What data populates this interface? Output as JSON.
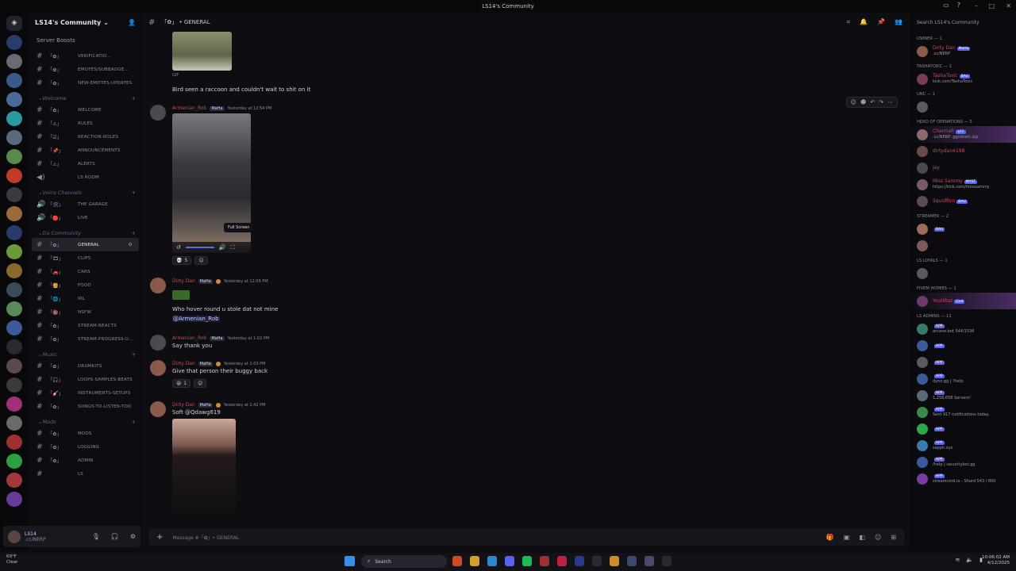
{
  "window": {
    "title": "LS14's Community"
  },
  "server": {
    "name": "LS14's Community",
    "boosts_label": "Server Boosts"
  },
  "channels": [
    {
      "type": "channel",
      "icon": "#",
      "emoji": "「✿」",
      "name": "verificatio..."
    },
    {
      "type": "channel",
      "icon": "#",
      "emoji": "「✿」",
      "name": "EMOTES/SUBBADGE..."
    },
    {
      "type": "channel",
      "icon": "#",
      "emoji": "「✿」",
      "name": "NEW-EMOTES-UPDATES"
    },
    {
      "type": "category",
      "name": "Welcome"
    },
    {
      "type": "channel",
      "icon": "#",
      "emoji": "「✿」",
      "name": "WELCOME"
    },
    {
      "type": "channel",
      "icon": "#",
      "emoji": "「⚠」",
      "name": "RULES"
    },
    {
      "type": "channel",
      "icon": "#",
      "emoji": "「☑」",
      "name": "REACTION-ROLES"
    },
    {
      "type": "channel",
      "icon": "#",
      "emoji": "「📌」",
      "name": "ANNOUNCEMENTS"
    },
    {
      "type": "channel",
      "icon": "#",
      "emoji": "「⚠」",
      "name": "ALERTS"
    },
    {
      "type": "channel",
      "icon": "◀)",
      "emoji": "",
      "name": "LS ROOM"
    },
    {
      "type": "category",
      "name": "Voice Channels"
    },
    {
      "type": "channel",
      "icon": "🔊",
      "emoji": "「🛠」",
      "name": "THE GARAGE"
    },
    {
      "type": "channel",
      "icon": "🔊",
      "emoji": "「🔴」",
      "name": "LIVE"
    },
    {
      "type": "category",
      "name": "Da Community"
    },
    {
      "type": "channel",
      "icon": "#",
      "emoji": "「✿」",
      "name": "GENERAL",
      "active": true
    },
    {
      "type": "channel",
      "icon": "#",
      "emoji": "「🎞」",
      "name": "CLIPS"
    },
    {
      "type": "channel",
      "icon": "#",
      "emoji": "「🚗」",
      "name": "CARS"
    },
    {
      "type": "channel",
      "icon": "#",
      "emoji": "「🍔」",
      "name": "FOOD"
    },
    {
      "type": "channel",
      "icon": "#",
      "emoji": "「🌐」",
      "name": "IRL"
    },
    {
      "type": "channel",
      "icon": "#",
      "emoji": "「🔞」",
      "name": "NSFW"
    },
    {
      "type": "channel",
      "icon": "#",
      "emoji": "「✿」",
      "name": "STREAM-REACTS"
    },
    {
      "type": "channel",
      "icon": "#",
      "emoji": "「✿」",
      "name": "STREAM-PROGRESS-U..."
    },
    {
      "type": "category",
      "name": "Music"
    },
    {
      "type": "channel",
      "icon": "#",
      "emoji": "「✿」",
      "name": "DRUMKITS"
    },
    {
      "type": "channel",
      "icon": "#",
      "emoji": "「🎧」",
      "name": "LOOPS-SAMPLES-BEATS"
    },
    {
      "type": "channel",
      "icon": "#",
      "emoji": "「🎸」",
      "name": "INSTRUMENTS-SETUPS"
    },
    {
      "type": "channel",
      "icon": "#",
      "emoji": "「✿」",
      "name": "SONGS-TO-LISTEN-TOO"
    },
    {
      "type": "category",
      "name": "Mods"
    },
    {
      "type": "channel",
      "icon": "#",
      "emoji": "「✿」",
      "name": "MODS"
    },
    {
      "type": "channel",
      "icon": "#",
      "emoji": "「✿」",
      "name": "LOGGING"
    },
    {
      "type": "channel",
      "icon": "#",
      "emoji": "「✿」",
      "name": "ADMIN"
    },
    {
      "type": "channel",
      "icon": "#",
      "emoji": "",
      "name": "ls"
    }
  ],
  "user_panel": {
    "name": "LS14",
    "status": ".cc/NERP"
  },
  "header": {
    "channel": "「✿」 • GENERAL"
  },
  "messages": {
    "gif_label": "GIF",
    "first_text": "Bird seen a raccoon and couldn't wait to shit on it",
    "m1": {
      "user": "Armenian_Rob",
      "tag": "MaHa",
      "time": "Yesterday at 12:54 PM",
      "reaction_count": "5"
    },
    "tooltip": "Full Screen",
    "m2": {
      "user": "Dirty Dan",
      "tag": "MaHa",
      "time": "Yesterday at 12:56 PM",
      "text": "Who hover round u stole dat not mine",
      "mention": "@Armenian_Rob"
    },
    "m3": {
      "user": "Armenian_Rob",
      "tag": "MaHa",
      "time": "Yesterday at 1:02 PM",
      "text": "Say thank you"
    },
    "m4": {
      "user": "Dirty Dan",
      "tag": "MaHa",
      "time": "Yesterday at 1:03 PM",
      "text": "Give that person their buggy back",
      "reaction_count": "1"
    },
    "m5": {
      "user": "Dirty Dan",
      "tag": "MaHa",
      "time": "Yesterday at 1:42 PM",
      "text": "Soft @Qdawg619"
    }
  },
  "composer": {
    "placeholder": "Message #「✿」• GENERAL"
  },
  "members": {
    "search_placeholder": "Search LS14's Community",
    "groups": [
      {
        "role": "OWNER — 1",
        "items": [
          {
            "name": "Dirty Dan",
            "sub": ".cc/NERP",
            "tag": "MaHa",
            "color": "#8a5a4a"
          }
        ]
      },
      {
        "role": "TashaToxic — 1",
        "items": [
          {
            "name": "TashaToxic",
            "sub": "kick.com/TashaToxic",
            "tag": "BAU",
            "color": "#7a3a5a"
          }
        ]
      },
      {
        "role": "UNC — 1",
        "items": [
          {
            "name": "",
            "sub": "",
            "tag": "",
            "color": "#5a5a64"
          }
        ]
      },
      {
        "role": "HEAD OF OPERATIONS — 5",
        "items": [
          {
            "name": "Charmah",
            "sub": ".cc/NERP .gg/steelc.ipp",
            "tag": "LFC",
            "color": "#8a6a6a"
          },
          {
            "name": "dirtydan4198",
            "sub": "",
            "tag": "",
            "color": "#6a4a4a"
          },
          {
            "name": "jay",
            "sub": "",
            "tag": "",
            "color": "#4a4a54"
          },
          {
            "name": "Miss Sammy",
            "sub": "https://kick.com/misssammy",
            "tag": "MYST",
            "color": "#7a5a6a"
          },
          {
            "name": "SquidRon",
            "sub": "",
            "tag": "BAU",
            "color": "#5a4a5a"
          }
        ]
      },
      {
        "role": "Streamer — 2",
        "items": [
          {
            "name": "",
            "sub": "",
            "tag": "BAU",
            "color": "#9a6a5a"
          },
          {
            "name": "",
            "sub": "",
            "tag": "",
            "color": "#7a5a5a"
          }
        ]
      },
      {
        "role": "LS Loyals — 1",
        "items": [
          {
            "name": "",
            "sub": "",
            "tag": "",
            "color": "#5a5a5a"
          }
        ]
      },
      {
        "role": "FIVEM HOMIES — 1",
        "items": [
          {
            "name": "YoutiRaz",
            "sub": "",
            "tag": "God",
            "color": "#6a3a6a"
          }
        ]
      },
      {
        "role": "LS ADMINS — 11",
        "items": [
          {
            "name": "",
            "sub": "arcane.bot 544/1536",
            "tag": "APP",
            "color": "#3a7a6a",
            "bot": true
          },
          {
            "name": "",
            "sub": "",
            "tag": "APP",
            "color": "#3a5a9a",
            "bot": true
          },
          {
            "name": "",
            "sub": "",
            "tag": "APP",
            "color": "#5a5a64",
            "bot": true
          },
          {
            "name": "",
            "sub": "dyno.gg | ?help",
            "tag": "APP",
            "color": "#3a5a9a",
            "bot": true
          },
          {
            "name": "",
            "sub": "1,258,658 Servers!",
            "tag": "APP",
            "color": "#5a6a7a",
            "bot": true
          },
          {
            "name": "",
            "sub": "Sent 917 notifications today.",
            "tag": "APP",
            "color": "#3a8a4a",
            "bot": true
          },
          {
            "name": "",
            "sub": "",
            "tag": "APP",
            "color": "#2aaa4a",
            "bot": true
          },
          {
            "name": "",
            "sub": "sapph.xyz",
            "tag": "APP",
            "color": "#3a7ab0",
            "bot": true
          },
          {
            "name": "",
            "sub": "/help | securitybot.gg",
            "tag": "APP",
            "color": "#3a5aa0",
            "bot": true
          },
          {
            "name": "",
            "sub": "streamcord.io - Shard 543 / 800",
            "tag": "APP",
            "color": "#7a3aa0",
            "bot": true
          }
        ]
      }
    ]
  },
  "taskbar": {
    "weather_temp": "69°F",
    "weather_desc": "Clear",
    "search_label": "Search",
    "time": "10:06:02 AM",
    "date": "4/12/2025"
  }
}
